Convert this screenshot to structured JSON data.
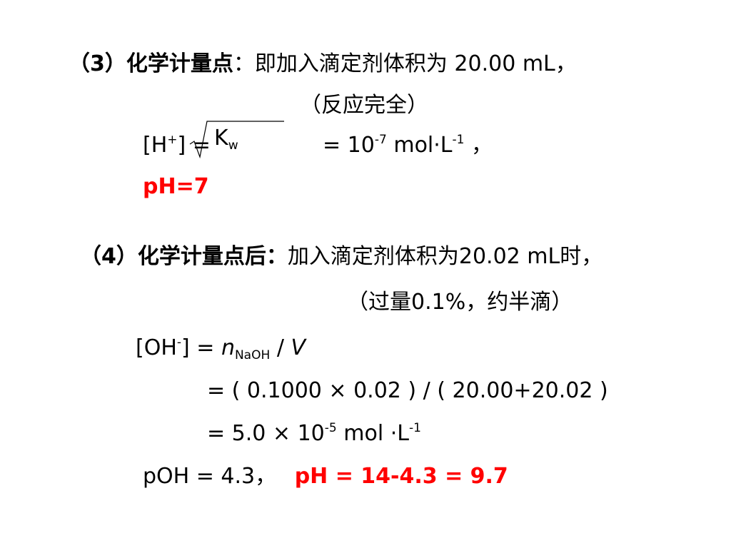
{
  "s3": {
    "heading": "（3）化学计量点",
    "colon": "：",
    "desc": "即加入滴定剂体积为 20.00 mL，",
    "note": "（反应完全）",
    "h_open": "[H",
    "h_sup": "+",
    "h_close": "] =",
    "kw_k": "K",
    "kw_sub": "w",
    "rhs_prefix": "= 10",
    "rhs_exp": "-7",
    "rhs_unit": " mol·L",
    "rhs_unit_exp": "-1",
    "rhs_end": " ，",
    "ph": "pH=7"
  },
  "s4": {
    "heading": "（4）化学计量点后：",
    "desc": "加入滴定剂体积为20.02 mL时，",
    "note": "（过量0.1%，约半滴）",
    "oh_open": "[OH",
    "oh_sup": "-",
    "oh_close": "] = ",
    "n": "n",
    "n_sub": "NaOH",
    "div_v": " / ",
    "v": "V",
    "calc1": "= ( 0.1000 × 0.02 ) / ( 20.00+20.02 )",
    "calc2_prefix": "= 5.0 × 10",
    "calc2_exp": "-5",
    "calc2_unit": " mol ·L",
    "calc2_unit_exp": "-1",
    "poh": "pOH = 4.3，",
    "ph_result": "pH = 14-4.3 = 9.7"
  }
}
